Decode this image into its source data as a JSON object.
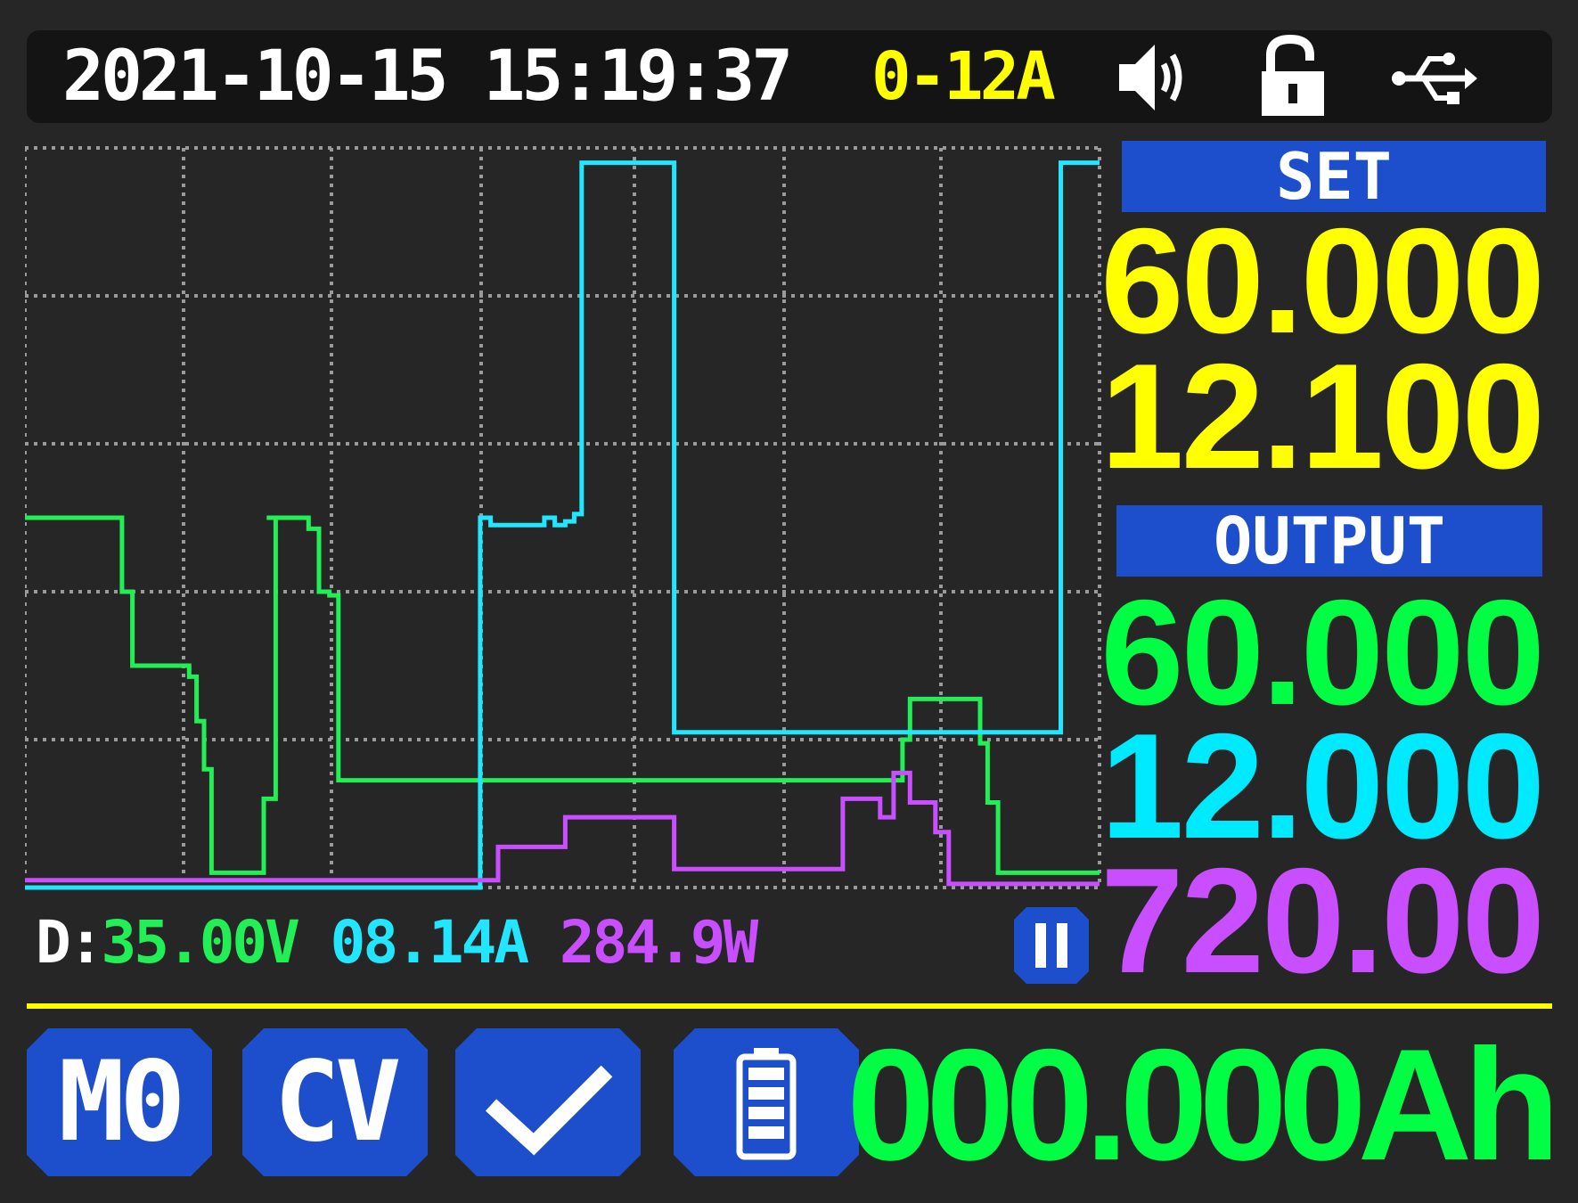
{
  "status_bar": {
    "datetime": "2021-10-15 15:19:37",
    "current_range": "0-12A",
    "icons": [
      "speaker-icon",
      "unlocked-padlock-icon",
      "usb-icon"
    ]
  },
  "chart_data": {
    "type": "line",
    "grid": true,
    "series": [
      {
        "color": "#22ee55",
        "x": [
          0,
          6.5,
          6.5,
          7.2,
          7.2,
          11,
          11,
          11.5,
          11.5,
          12,
          12,
          12.5,
          12.5,
          16,
          16,
          16.8,
          16.8,
          16.2,
          16.2,
          19,
          19,
          19.7,
          19.7,
          20.4,
          20.4,
          21,
          21,
          58.8,
          58.8,
          59.3,
          59.3,
          64,
          64,
          64.5,
          64.5,
          65.2,
          65.2,
          72
        ],
        "y": [
          5,
          5,
          4,
          4,
          3,
          3,
          2.85,
          2.85,
          2.25,
          2.25,
          1.6,
          1.6,
          0.2,
          0.2,
          1.2,
          1.2,
          5,
          5,
          5,
          5,
          4.85,
          4.85,
          4,
          4,
          3.95,
          3.95,
          1.45,
          1.45,
          2,
          2,
          2.55,
          2.55,
          1.95,
          1.95,
          1.15,
          1.15,
          0.2,
          0.2
        ]
      },
      {
        "color": "#22e6ff",
        "x": [
          0,
          30.5,
          30.5,
          31.2,
          31.2,
          34.8,
          34.8,
          35.5,
          35.5,
          36.2,
          36.2,
          36.8,
          36.8,
          37.3,
          37.3,
          43.5,
          43.5,
          69.4,
          69.4,
          71.5,
          71.5,
          72
        ],
        "y": [
          0,
          0,
          5,
          5,
          4.9,
          4.9,
          5,
          5,
          4.9,
          4.9,
          4.95,
          4.95,
          5.05,
          5.05,
          9.8,
          9.8,
          2.1,
          2.1,
          9.8,
          9.8,
          9.8,
          9.8
        ]
      },
      {
        "color": "#c84eff",
        "x": [
          0,
          31.7,
          31.7,
          36.2,
          36.2,
          43.5,
          43.5,
          54.8,
          54.8,
          57.3,
          57.3,
          58.2,
          58.2,
          59.3,
          59.3,
          61,
          61,
          61.9,
          61.9,
          64,
          64,
          66,
          66,
          72
        ],
        "y": [
          0.1,
          0.1,
          0.55,
          0.55,
          0.95,
          0.95,
          0.25,
          0.25,
          1.2,
          1.2,
          0.95,
          0.95,
          1.55,
          1.55,
          1.15,
          1.15,
          0.75,
          0.75,
          0.05,
          0.05,
          0.05,
          0.05,
          0.05,
          0.05
        ]
      }
    ]
  },
  "set_panel": {
    "label": "SET",
    "voltage": "60.000",
    "current": "12.100"
  },
  "output_panel": {
    "label": "OUTPUT",
    "voltage": "60.000",
    "current": "12.000",
    "power": "720.00"
  },
  "data_line": {
    "prefix": "D:",
    "voltage": "35.00V",
    "current": "08.14A",
    "power": "284.9W"
  },
  "bottom_bar": {
    "memory": "M0",
    "mode": "CV",
    "capacity": "000.000Ah"
  },
  "colors": {
    "set_values": "#ffff00",
    "output_voltage": "#00ff44",
    "output_current": "#00eaff",
    "output_power": "#c84eff",
    "label_bg": "#1d4fcc",
    "divider": "#ffff00"
  }
}
